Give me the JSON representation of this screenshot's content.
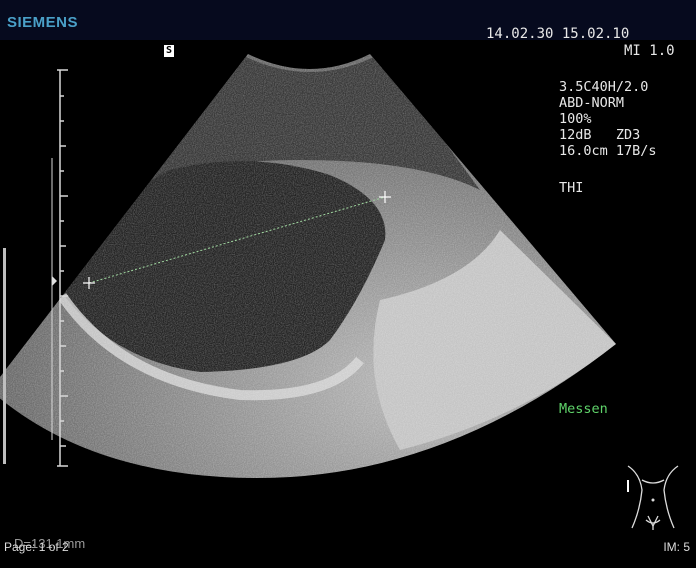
{
  "header": {
    "brand": "SIEMENS",
    "datetime": "14.02.30 15.02.10",
    "mi": "MI 1.0"
  },
  "marker": "S",
  "params": {
    "probe": "3.5C40H/2.0",
    "preset": "ABD-NORM",
    "power": "100%",
    "gain_zoom": "12dB   ZD3",
    "depth_rate": "16.0cm 17B/s",
    "mode": "THI"
  },
  "status": {
    "messen": "Messen",
    "measurement": "D=131.1mm",
    "page": "Page: 1 of 2",
    "image_number": "IM: 5"
  },
  "colors": {
    "brand": "#4aa0c8",
    "messen": "#5fd36a",
    "caliper": "#a0d8a0"
  }
}
